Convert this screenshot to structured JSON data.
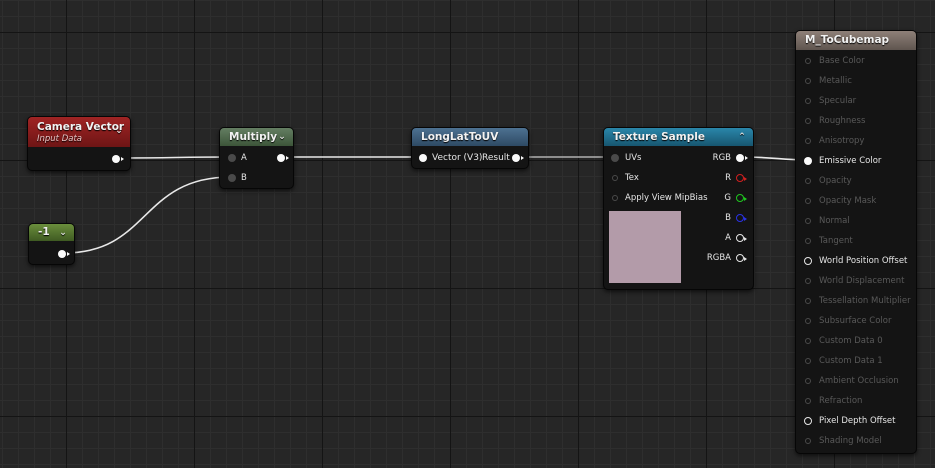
{
  "nodes": {
    "camera_vector": {
      "title": "Camera Vector",
      "subtitle": "Input Data"
    },
    "constant": {
      "title": "-1"
    },
    "multiply": {
      "title": "Multiply",
      "input_a": "A",
      "input_b": "B"
    },
    "longlat": {
      "title": "LongLatToUV",
      "input": "Vector (V3)",
      "output": "Result"
    },
    "texture_sample": {
      "title": "Texture Sample",
      "inputs": [
        "UVs",
        "Tex",
        "Apply View MipBias"
      ],
      "outputs": [
        "RGB",
        "R",
        "G",
        "B",
        "A",
        "RGBA"
      ],
      "preview_color": "#b39ba9"
    },
    "material": {
      "title": "M_ToCubemap",
      "pins": [
        "Base Color",
        "Metallic",
        "Specular",
        "Roughness",
        "Anisotropy",
        "Emissive Color",
        "Opacity",
        "Opacity Mask",
        "Normal",
        "Tangent",
        "World Position Offset",
        "World Displacement",
        "Tessellation Multiplier",
        "Subsurface Color",
        "Custom Data 0",
        "Custom Data 1",
        "Ambient Occlusion",
        "Refraction",
        "Pixel Depth Offset",
        "Shading Model"
      ]
    }
  },
  "colors": {
    "header_input": "#8c1b1b",
    "header_constant": "#4e6b2c",
    "header_math": "#4c6a4a",
    "header_function": "#3a5874",
    "header_texture": "#1f6a8a",
    "header_material": "#7a6d64",
    "pin_red": "#d22020",
    "pin_green": "#1fc81f",
    "pin_blue": "#2a32e6"
  },
  "icons": {
    "collapse": "chevron-down-icon",
    "expand": "chevron-up-icon"
  }
}
